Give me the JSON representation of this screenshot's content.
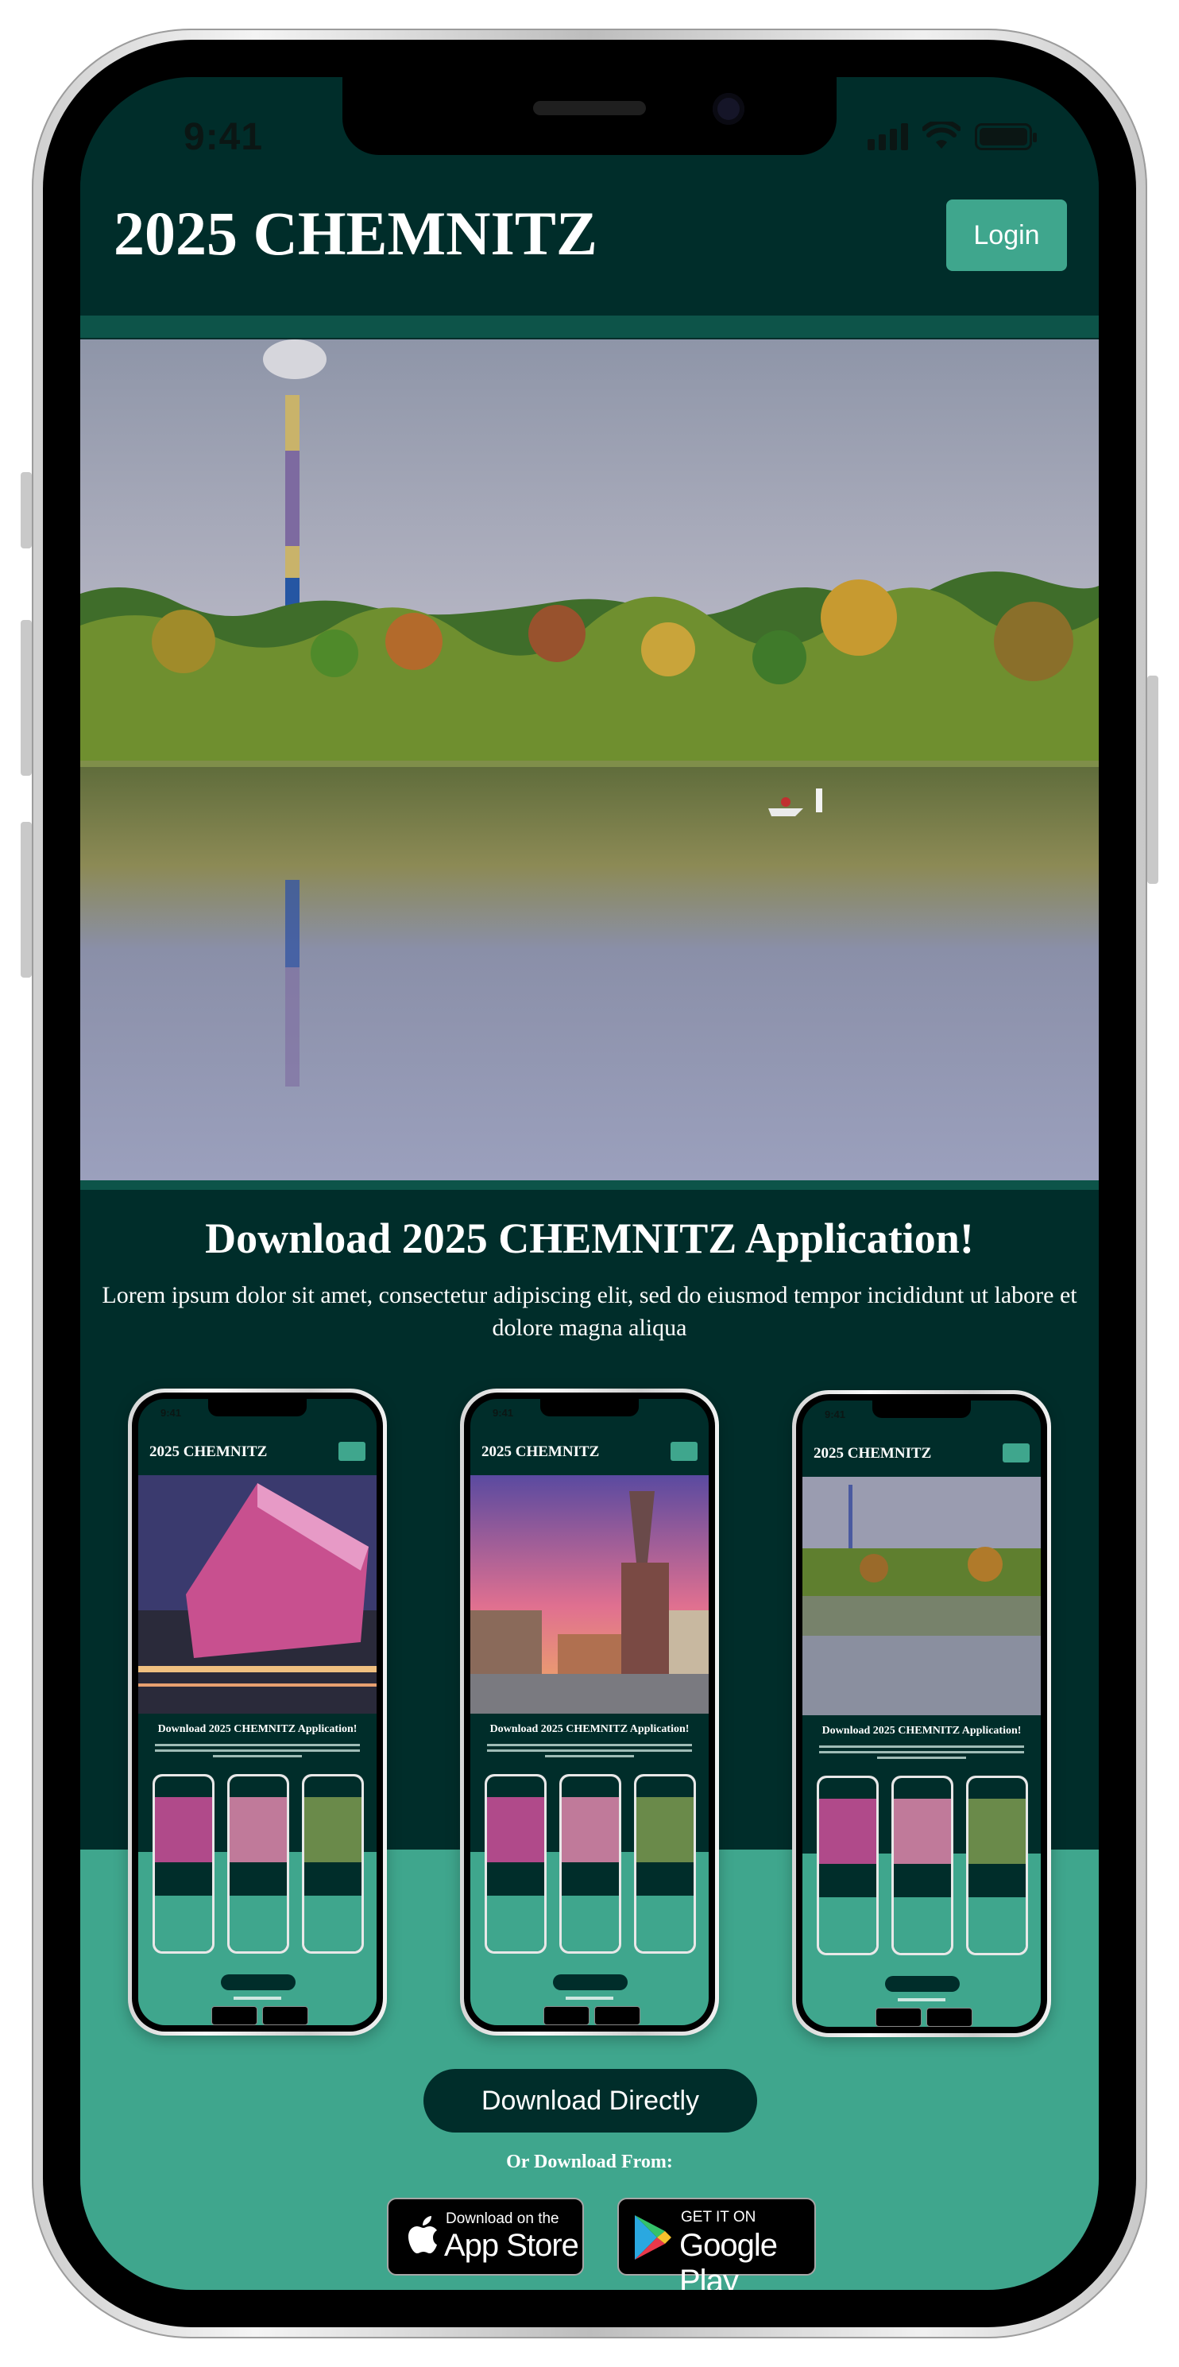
{
  "status_bar": {
    "time": "9:41"
  },
  "header": {
    "title": "2025 CHEMNITZ",
    "login_label": "Login"
  },
  "download_section": {
    "heading": "Download 2025 CHEMNITZ Application!",
    "description": "Lorem ipsum dolor sit amet, consectetur adipiscing elit, sed do eiusmod tempor incididunt ut labore et dolore magna aliqua",
    "download_button": "Download Directly",
    "or_download_from": "Or Download From:"
  },
  "store_badges": {
    "apple": {
      "small": "Download on the",
      "big": "App Store"
    },
    "google": {
      "small": "GET IT ON",
      "big": "Google Play"
    }
  },
  "previews": [
    {
      "time": "9:41",
      "title": "2025 CHEMNITZ",
      "heading": "Download 2025 CHEMNITZ Application!",
      "image": "modern-building-night"
    },
    {
      "time": "9:41",
      "title": "2025 CHEMNITZ",
      "heading": "Download 2025 CHEMNITZ Application!",
      "image": "city-hall-sunset"
    },
    {
      "time": "9:41",
      "title": "2025 CHEMNITZ",
      "heading": "Download 2025 CHEMNITZ Application!",
      "image": "lake-chimney"
    }
  ],
  "colors": {
    "dark": "#002d2a",
    "accent": "#3fa68d",
    "strip": "#0d5449"
  }
}
